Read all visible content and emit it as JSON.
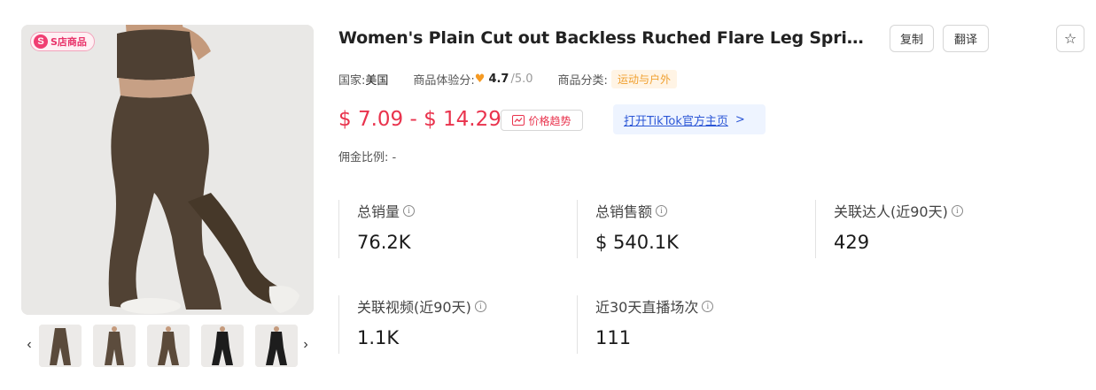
{
  "gallery": {
    "badge_label": "S店商品",
    "badge_logo": "S",
    "prev_arrow": "‹",
    "next_arrow": "›",
    "thumbnails": [
      {
        "color": "#5a4a3b"
      },
      {
        "color": "#5c4c3d"
      },
      {
        "color": "#5b4a3a"
      },
      {
        "color": "#1c1c1c"
      },
      {
        "color": "#1d1d1d"
      }
    ]
  },
  "product": {
    "title": "Women's Plain Cut out Backless Ruched Flare Leg Spring Sports...",
    "copy_label": "复制",
    "translate_label": "翻译",
    "favorite_icon": "☆"
  },
  "meta": {
    "country_label": "国家:",
    "country_value": "美国",
    "experience_label": "商品体验分:",
    "rating": "4.7",
    "rating_max": "/5.0",
    "category_label": "商品分类:",
    "category_value": "运动与户外"
  },
  "pricing": {
    "price_range": "$ 7.09 - $ 14.29",
    "trend_label": "价格趋势",
    "tiktok_link": "打开TikTok官方主页",
    "tiktok_chevron": ">",
    "commission_label": "佣金比例:",
    "commission_value": "-"
  },
  "stats": {
    "total_sales": {
      "label": "总销量",
      "value": "76.2K"
    },
    "total_revenue": {
      "label": "总销售额",
      "value": "$ 540.1K"
    },
    "related_creators": {
      "label": "关联达人(近90天)",
      "value": "429"
    },
    "related_videos": {
      "label": "关联视频(近90天)",
      "value": "1.1K"
    },
    "live_sessions": {
      "label": "近30天直播场次",
      "value": "111"
    }
  },
  "colors": {
    "price": "#e9334d",
    "badge": "#f03e72",
    "link": "#2b56d6",
    "category_tag_bg": "#fff4e5",
    "category_tag_text": "#f0a030",
    "heart": "#f59a23"
  }
}
